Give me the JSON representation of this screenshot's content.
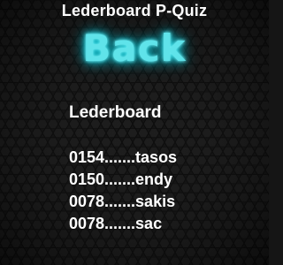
{
  "screen": {
    "title": "Lederboard P-Quiz",
    "back_label": "Back",
    "glow_color": "#5fe3ea",
    "background_pattern": "dark-hexagon-mesh"
  },
  "leaderboard": {
    "heading": "Lederboard",
    "rows": [
      "0154.......tasos",
      "0150.......endy",
      "0078.......sakis",
      "0078.......sac"
    ]
  }
}
